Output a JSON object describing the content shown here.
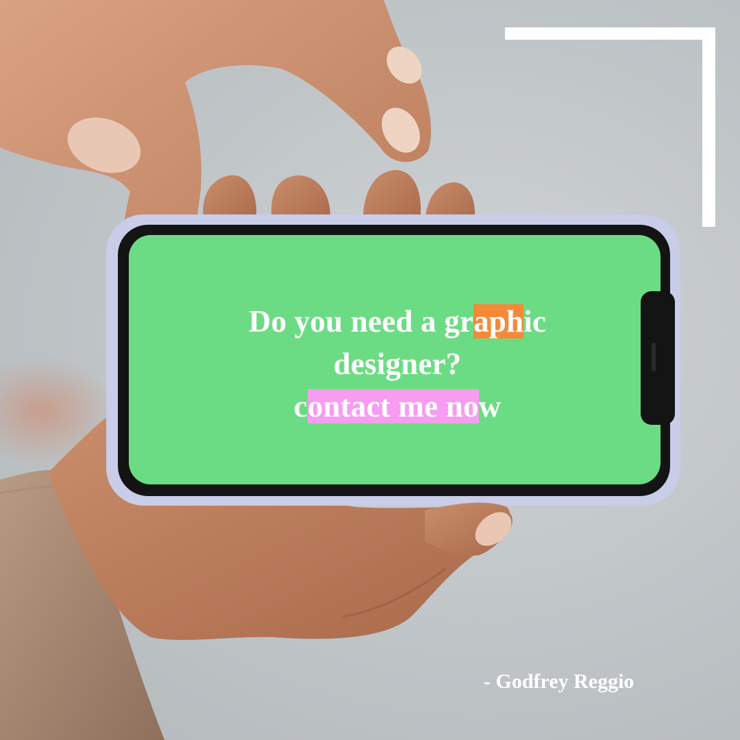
{
  "headline": {
    "line1_pre": "Do you need a gr",
    "line1_highlight": "aph",
    "line1_post": "ic",
    "line2": "designer?",
    "line3_pre": "c",
    "line3_highlight": "ontact me no",
    "line3_post": "w"
  },
  "attribution": "- Godfrey Reggio",
  "colors": {
    "screen_green": "#6cdc84",
    "highlight_orange": "#f5893a",
    "highlight_pink": "#f79cf2",
    "frame_white": "#ffffff",
    "phone_case": "#c9cde8"
  }
}
